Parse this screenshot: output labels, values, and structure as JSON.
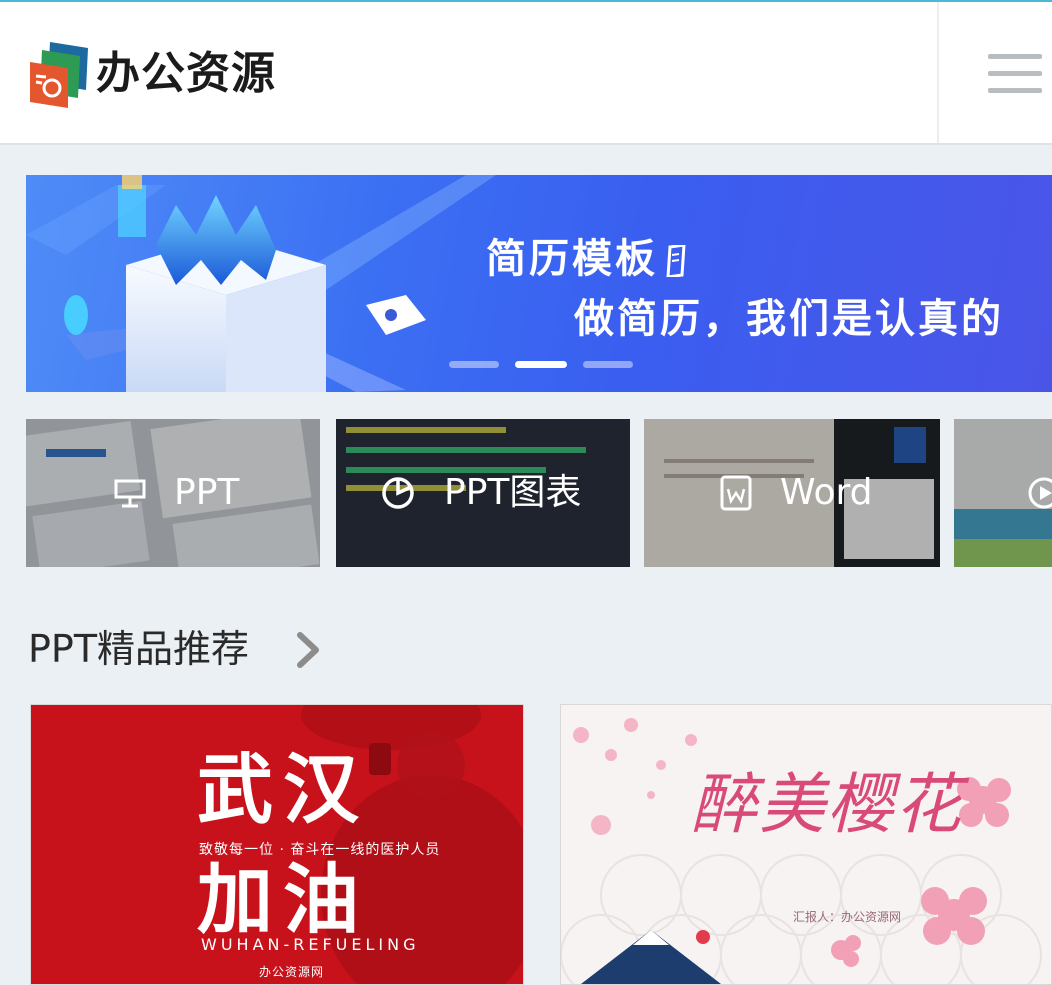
{
  "header": {
    "brand": "办公资源",
    "logo_icon": "document-stack-logo-icon",
    "menu_icon": "hamburger-menu-icon"
  },
  "banner": {
    "title": "简历模板",
    "subtitle": "做简历，我们是认真的",
    "slides": 3,
    "active_slide": 2
  },
  "categories": [
    {
      "label": "PPT",
      "icon": "presentation-icon"
    },
    {
      "label": "PPT图表",
      "icon": "pie-chart-icon"
    },
    {
      "label": "Word",
      "icon": "word-document-icon"
    },
    {
      "label": "",
      "icon": "play-icon"
    }
  ],
  "section": {
    "title": "PPT精品推荐",
    "more_icon": "chevron-right-icon"
  },
  "cards": [
    {
      "headline_1": "武汉",
      "headline_2": "加油",
      "tagline": "致敬每一位 · 奋斗在一线的医护人员",
      "subtitle_en": "WUHAN-REFUELING",
      "source": "办公资源网"
    },
    {
      "title": "醉美樱花",
      "reporter": "汇报人：办公资源网"
    }
  ],
  "colors": {
    "accent_line": "#4bb9d6",
    "banner_blue": "#3b6ff3",
    "wuhan_red": "#c8121b",
    "sakura_pink": "#d94a78"
  }
}
